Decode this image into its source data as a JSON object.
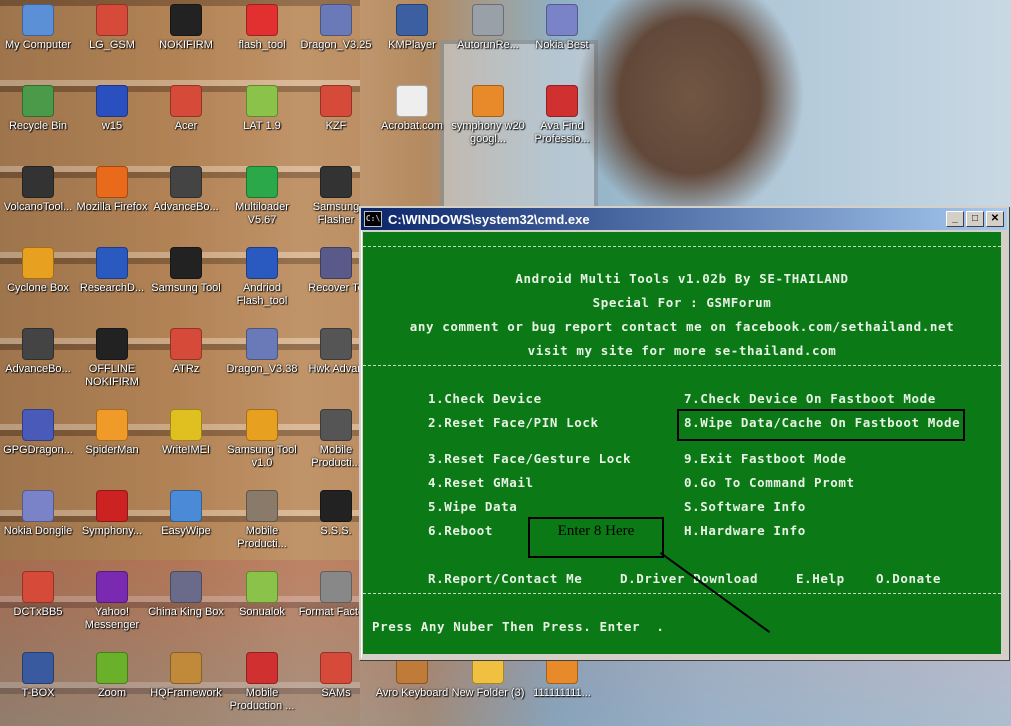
{
  "desktop_icons": [
    {
      "label": "My Computer",
      "icon": "computer-icon",
      "color": "#5b8fd6"
    },
    {
      "label": "LG_GSM",
      "icon": "app-shortcut-icon",
      "color": "#d64a3a"
    },
    {
      "label": "NOKIFIRM",
      "icon": "cube-icon",
      "color": "#222222"
    },
    {
      "label": "flash_tool",
      "icon": "arrow-icon",
      "color": "#e23030"
    },
    {
      "label": "Dragon_V3.25",
      "icon": "dragon-icon",
      "color": "#6a7ab8"
    },
    {
      "label": "KMPlayer",
      "icon": "kmp-icon",
      "color": "#3b5fa0"
    },
    {
      "label": "AutorunRe...",
      "icon": "search-icon",
      "color": "#9aa0a8"
    },
    {
      "label": "Nokia Best",
      "icon": "dragon-icon",
      "color": "#7a82c8"
    },
    {
      "label": "Recycle Bin",
      "icon": "recycle-bin-icon",
      "color": "#4a9a4a"
    },
    {
      "label": "w15",
      "icon": "app-shortcut-icon",
      "color": "#2a50c0"
    },
    {
      "label": "Acer",
      "icon": "app-shortcut-icon",
      "color": "#d64a3a"
    },
    {
      "label": "LAT 1.9",
      "icon": "android-icon",
      "color": "#8bc34a"
    },
    {
      "label": "KZF",
      "icon": "app-shortcut-icon",
      "color": "#d64a3a"
    },
    {
      "label": "Acrobat.com",
      "icon": "acrobat-icon",
      "color": "#eeeeee"
    },
    {
      "label": "symphony w20 googl...",
      "icon": "archive-icon",
      "color": "#e88a2a"
    },
    {
      "label": "Ava Find Professio...",
      "icon": "compass-icon",
      "color": "#d03030"
    },
    {
      "label": "VolcanoTool...",
      "icon": "volcano-icon",
      "color": "#333333"
    },
    {
      "label": "Mozilla Firefox",
      "icon": "firefox-icon",
      "color": "#e86a1a"
    },
    {
      "label": "AdvanceBo...",
      "icon": "box-icon",
      "color": "#444444"
    },
    {
      "label": "Multiloader V5.67",
      "icon": "green-arrow-icon",
      "color": "#2aa84a"
    },
    {
      "label": "Samsung Flasher",
      "icon": "samsung-icon",
      "color": "#333333"
    },
    {
      "label": "Cyclone Box",
      "icon": "cyclone-icon",
      "color": "#e8a020"
    },
    {
      "label": "ResearchD...",
      "icon": "download-icon",
      "color": "#2a5ac0"
    },
    {
      "label": "Samsung Tool",
      "icon": "tool-icon",
      "color": "#222222"
    },
    {
      "label": "Andriod Flash_tool",
      "icon": "flash-icon",
      "color": "#2a5ac0"
    },
    {
      "label": "Recover To",
      "icon": "recover-icon",
      "color": "#5a5a8a"
    },
    {
      "label": "AdvanceBo...",
      "icon": "box-icon",
      "color": "#444444"
    },
    {
      "label": "OFFLINE NOKIFIRM",
      "icon": "cube-icon",
      "color": "#222222"
    },
    {
      "label": "ATRz",
      "icon": "app-shortcut-icon",
      "color": "#d64a3a"
    },
    {
      "label": "Dragon_V3.38",
      "icon": "dragon-icon",
      "color": "#6a7ab8"
    },
    {
      "label": "Hwk Advan",
      "icon": "hwk-icon",
      "color": "#555555"
    },
    {
      "label": "GPGDragon...",
      "icon": "dragon-icon",
      "color": "#4a5ab8"
    },
    {
      "label": "SpiderMan",
      "icon": "home-icon",
      "color": "#f09a2a"
    },
    {
      "label": "WriteIMEI",
      "icon": "imei-icon",
      "color": "#e0c020"
    },
    {
      "label": "Samsung Tool v1.0",
      "icon": "lock-icon",
      "color": "#e8a020"
    },
    {
      "label": "Mobile Producti...",
      "icon": "mobile-icon",
      "color": "#555555"
    },
    {
      "label": "Nokia Dongile",
      "icon": "dragon-icon",
      "color": "#7a82c8"
    },
    {
      "label": "Symphony...",
      "icon": "symphony-icon",
      "color": "#cc2222"
    },
    {
      "label": "EasyWipe",
      "icon": "disc-icon",
      "color": "#4a8ad6"
    },
    {
      "label": "Mobile Producti...",
      "icon": "package-icon",
      "color": "#8a7a6a"
    },
    {
      "label": "S.S.S.",
      "icon": "sss-icon",
      "color": "#222222"
    },
    {
      "label": "DCTxBB5",
      "icon": "app-shortcut-icon",
      "color": "#d64a3a"
    },
    {
      "label": "Yahoo! Messenger",
      "icon": "yahoo-icon",
      "color": "#7a2ab0"
    },
    {
      "label": "China King Box",
      "icon": "gear-icon",
      "color": "#6a6a8a"
    },
    {
      "label": "Sonualok",
      "icon": "android-icon",
      "color": "#8bc34a"
    },
    {
      "label": "Format Factory",
      "icon": "format-icon",
      "color": "#888888"
    },
    {
      "label": "T-BOX",
      "icon": "tbox-icon",
      "color": "#3a5aa0"
    },
    {
      "label": "Zoom",
      "icon": "zoom-icon",
      "color": "#6ab02a"
    },
    {
      "label": "HQFramework",
      "icon": "gift-icon",
      "color": "#c08a3a"
    },
    {
      "label": "Mobile Production ...",
      "icon": "cubes-icon",
      "color": "#d03030"
    },
    {
      "label": "SAMs",
      "icon": "app-shortcut-icon",
      "color": "#d64a3a"
    },
    {
      "label": "Avro Keyboard",
      "icon": "keyboard-icon",
      "color": "#c07a3a"
    },
    {
      "label": "New Folder (3)",
      "icon": "folder-icon",
      "color": "#f0c040"
    },
    {
      "label": "111111111...",
      "icon": "archive-icon",
      "color": "#e88a2a"
    }
  ],
  "cmd_window": {
    "title": "C:\\WINDOWS\\system32\\cmd.exe",
    "icon_text": "C:\\",
    "minimize": "_",
    "maximize": "□",
    "close": "✕",
    "header_lines": [
      "Android Multi Tools v1.02b By SE-THAILAND",
      "Special For : GSMForum",
      "any comment or bug report contact me on facebook.com/sethailand.net",
      "visit my site for more se-thailand.com"
    ],
    "menu_left": [
      "1.Check Device",
      "2.Reset Face/PIN Lock",
      "3.Reset Face/Gesture Lock",
      "4.Reset GMail",
      "5.Wipe Data",
      "6.Reboot"
    ],
    "menu_right": [
      "7.Check Device On Fastboot Mode",
      "8.Wipe Data/Cache On Fastboot Mode",
      "9.Exit Fastboot Mode",
      "0.Go To Command Promt",
      "S.Software Info",
      "H.Hardware Info"
    ],
    "footer_options": [
      "R.Report/Contact Me",
      "D.Driver Download",
      "E.Help",
      "O.Donate"
    ],
    "prompt": "Press Any Nuber Then Press. Enter  .",
    "annotation": "Enter 8 Here"
  }
}
